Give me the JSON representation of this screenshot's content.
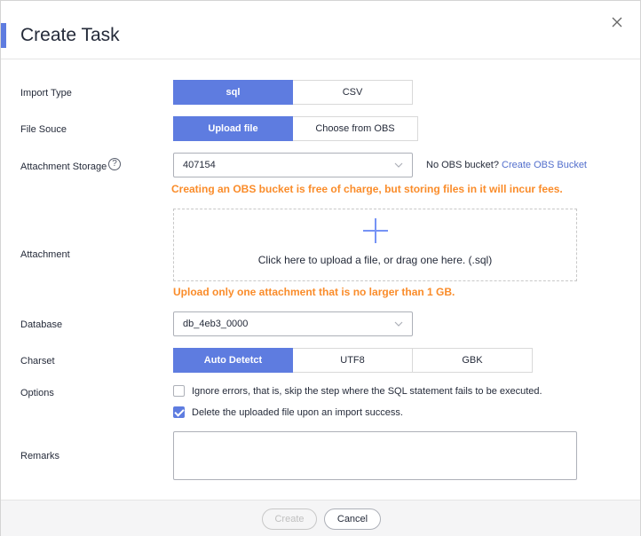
{
  "dialog": {
    "title": "Create Task",
    "close_label": "X"
  },
  "import_type": {
    "label": "Import Type",
    "options": [
      "sql",
      "CSV"
    ],
    "selected": "sql"
  },
  "file_source": {
    "label": "File Souce",
    "options": [
      "Upload file",
      "Choose from OBS"
    ],
    "selected": "Upload file"
  },
  "attachment_storage": {
    "label": "Attachment Storage",
    "help_icon": "?",
    "value": "407154",
    "no_bucket_text": "No OBS bucket?",
    "create_bucket_link": "Create OBS Bucket",
    "warning": "Creating an OBS bucket is free of charge, but storing files in it will incur fees."
  },
  "attachment": {
    "label": "Attachment",
    "upload_text": "Click here to upload a file, or drag one here. (.sql)",
    "warning": "Upload only one attachment that is no larger than 1 GB."
  },
  "database": {
    "label": "Database",
    "value": "db_4eb3_0000"
  },
  "charset": {
    "label": "Charset",
    "options": [
      "Auto Detetct",
      "UTF8",
      "GBK"
    ],
    "selected": "Auto Detetct"
  },
  "options": {
    "label": "Options",
    "items": [
      {
        "text": "Ignore errors, that is, skip the step where the SQL statement fails to be executed.",
        "checked": false
      },
      {
        "text": "Delete the uploaded file upon an import success.",
        "checked": true
      }
    ]
  },
  "remarks": {
    "label": "Remarks",
    "value": ""
  },
  "footer": {
    "create_label": "Create",
    "cancel_label": "Cancel"
  },
  "colors": {
    "accent": "#5e7ce0",
    "warning": "#fa8c2a",
    "link": "#526ecc"
  },
  "icons": {
    "close": "close-icon",
    "help": "question-circle-icon",
    "chevron": "chevron-down-icon",
    "upload": "plus-icon",
    "check": "check-icon"
  }
}
